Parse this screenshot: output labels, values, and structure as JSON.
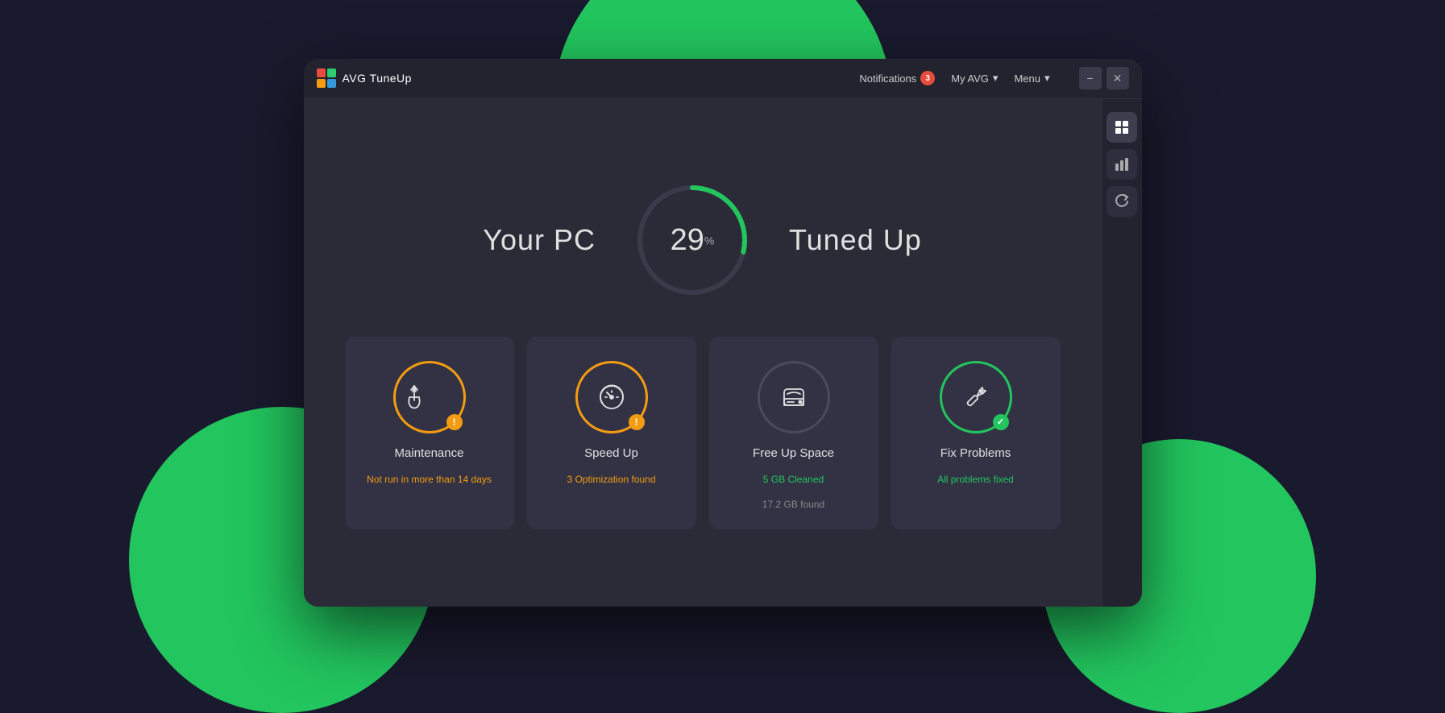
{
  "app": {
    "logo_text": "AVG TuneUp",
    "titlebar": {
      "notifications_label": "Notifications",
      "notifications_count": "3",
      "my_avg_label": "My AVG",
      "menu_label": "Menu",
      "minimize_label": "−",
      "close_label": "✕"
    }
  },
  "sidebar": {
    "icons": [
      {
        "name": "grid-icon",
        "symbol": "⊞",
        "active": true
      },
      {
        "name": "bar-chart-icon",
        "symbol": "▐",
        "active": false
      },
      {
        "name": "refresh-icon",
        "symbol": "↺",
        "active": false
      }
    ]
  },
  "hero": {
    "left_text": "Your PC",
    "right_text": "Tuned Up",
    "gauge_value": "29",
    "gauge_unit": "%"
  },
  "cards": [
    {
      "id": "maintenance",
      "title": "Maintenance",
      "status": "Not run in more than 14 days",
      "status_type": "warning",
      "status_sub": "",
      "icon_type": "broom",
      "badge_type": "alert",
      "circle_color": "orange"
    },
    {
      "id": "speed-up",
      "title": "Speed Up",
      "status": "3 Optimization found",
      "status_type": "warning",
      "status_sub": "",
      "icon_type": "speedometer",
      "badge_type": "alert",
      "circle_color": "orange"
    },
    {
      "id": "free-up-space",
      "title": "Free Up Space",
      "status": "5 GB Cleaned",
      "status_type": "green",
      "status_sub": "17.2 GB found",
      "icon_type": "hdd",
      "badge_type": "none",
      "circle_color": "gray"
    },
    {
      "id": "fix-problems",
      "title": "Fix Problems",
      "status": "All problems fixed",
      "status_type": "green",
      "status_sub": "",
      "icon_type": "wrench",
      "badge_type": "check",
      "circle_color": "green"
    }
  ]
}
